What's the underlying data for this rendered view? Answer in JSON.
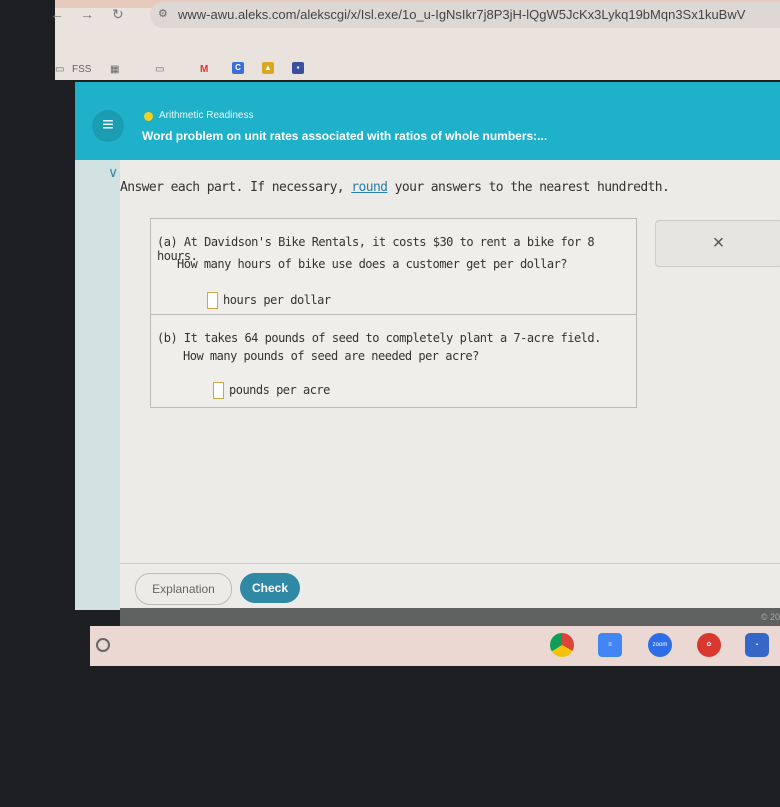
{
  "browser": {
    "url": "www-awu.aleks.com/alekscgi/x/Isl.exe/1o_u-IgNsIkr7j8P3jH-lQgW5JcKx3Lykq19bMqn3Sx1kuBwV",
    "bookmarks": [
      "FSS"
    ]
  },
  "header": {
    "category": "Arithmetic Readiness",
    "title": "Word problem on unit rates associated with ratios of whole numbers:..."
  },
  "instructions": {
    "before": "Answer each part. If necessary, ",
    "link": "round",
    "after": " your answers to the nearest hundredth."
  },
  "questions": [
    {
      "label": "(a)",
      "line1": "At Davidson's Bike Rentals, it costs $30 to rent a bike for 8 hours.",
      "line2": "How many hours of bike use does a customer get per dollar?",
      "unit": "hours per dollar",
      "value": ""
    },
    {
      "label": "(b)",
      "line1": "It takes 64 pounds of seed to completely plant a 7-acre field.",
      "line2": "How many pounds of seed are needed per acre?",
      "unit": "pounds per acre",
      "value": ""
    }
  ],
  "close_label": "×",
  "buttons": {
    "explanation": "Explanation",
    "check": "Check"
  },
  "footer": {
    "copyright": "© 20"
  },
  "taskbar": {
    "zoom_label": "zoom"
  },
  "colors": {
    "header": "#1fb1c9",
    "check": "#2f89a5"
  }
}
